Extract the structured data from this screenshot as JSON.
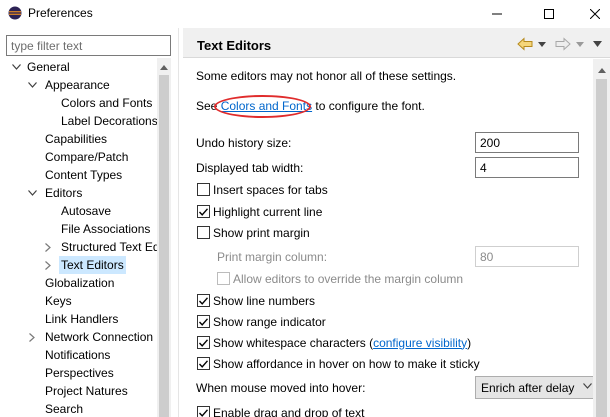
{
  "window": {
    "title": "Preferences"
  },
  "sidebar": {
    "filter_placeholder": "type filter text",
    "items": [
      {
        "label": "General",
        "level": 0,
        "expander": "expanded"
      },
      {
        "label": "Appearance",
        "level": 1,
        "expander": "expanded"
      },
      {
        "label": "Colors and Fonts",
        "level": 2,
        "expander": "none"
      },
      {
        "label": "Label Decorations",
        "level": 2,
        "expander": "none"
      },
      {
        "label": "Capabilities",
        "level": 1,
        "expander": "none"
      },
      {
        "label": "Compare/Patch",
        "level": 1,
        "expander": "none"
      },
      {
        "label": "Content Types",
        "level": 1,
        "expander": "none"
      },
      {
        "label": "Editors",
        "level": 1,
        "expander": "expanded"
      },
      {
        "label": "Autosave",
        "level": 2,
        "expander": "none"
      },
      {
        "label": "File Associations",
        "level": 2,
        "expander": "none"
      },
      {
        "label": "Structured Text Ed",
        "level": 2,
        "expander": "collapsed"
      },
      {
        "label": "Text Editors",
        "level": 2,
        "expander": "collapsed",
        "selected": true
      },
      {
        "label": "Globalization",
        "level": 1,
        "expander": "none"
      },
      {
        "label": "Keys",
        "level": 1,
        "expander": "none"
      },
      {
        "label": "Link Handlers",
        "level": 1,
        "expander": "none"
      },
      {
        "label": "Network Connection",
        "level": 1,
        "expander": "collapsed"
      },
      {
        "label": "Notifications",
        "level": 1,
        "expander": "none"
      },
      {
        "label": "Perspectives",
        "level": 1,
        "expander": "none"
      },
      {
        "label": "Project Natures",
        "level": 1,
        "expander": "none"
      },
      {
        "label": "Search",
        "level": 1,
        "expander": "none"
      }
    ]
  },
  "page": {
    "title": "Text Editors",
    "notice": "Some editors may not honor all of these settings.",
    "see_prefix": "See ",
    "see_link": "Colors and Fonts",
    "see_suffix": " to configure the font.",
    "undo_label": "Undo history size:",
    "undo_value": "200",
    "tab_width_label": "Displayed tab width:",
    "tab_width_value": "4",
    "insert_spaces": {
      "label": "Insert spaces for tabs",
      "checked": false
    },
    "highlight_line": {
      "label": "Highlight current line",
      "checked": true
    },
    "print_margin": {
      "label": "Show print margin",
      "checked": false
    },
    "print_margin_col_label": "Print margin column:",
    "print_margin_col_value": "80",
    "allow_override": {
      "label": "Allow editors to override the margin column",
      "checked": false
    },
    "line_numbers": {
      "label": "Show line numbers",
      "checked": true
    },
    "range_indicator": {
      "label": "Show range indicator",
      "checked": true
    },
    "whitespace": {
      "label": "Show whitespace characters (",
      "link": "configure visibility",
      "suffix": ")",
      "checked": true
    },
    "affordance": {
      "label": "Show affordance in hover on how to make it sticky",
      "checked": true
    },
    "hover_label": "When mouse moved into hover:",
    "hover_value": "Enrich after delay",
    "drag_drop": {
      "label": "Enable drag and drop of text",
      "checked": true
    }
  },
  "colors": {
    "link": "#0066cc",
    "annotation": "#e02c2c",
    "selection": "#cce8ff",
    "header_bg": "#f0f0f0"
  },
  "icons": [
    "eclipse-icon",
    "minimize-icon",
    "maximize-icon",
    "close-icon",
    "back-arrow-icon",
    "forward-arrow-icon",
    "view-menu-icon",
    "checkmark-icon"
  ]
}
